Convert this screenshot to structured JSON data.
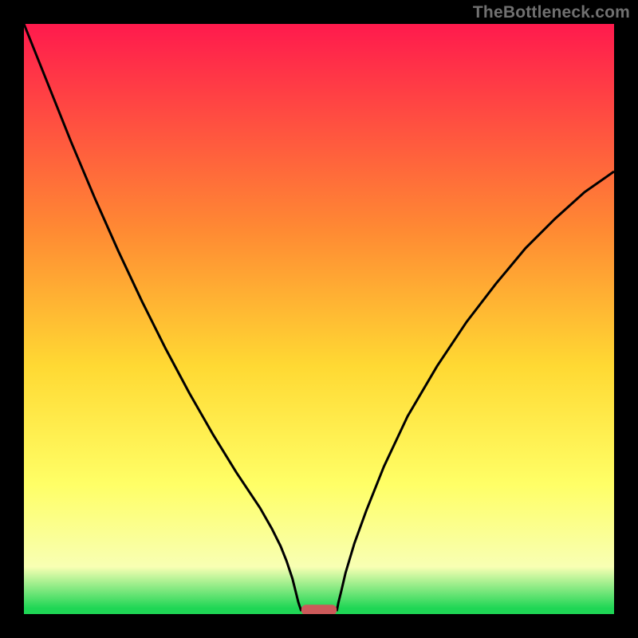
{
  "attribution": "TheBottleneck.com",
  "colors": {
    "frame_bg": "#000000",
    "gradient_top": "#ff1a4d",
    "gradient_mid1": "#ff8a33",
    "gradient_mid2": "#ffd933",
    "gradient_mid3": "#ffff66",
    "gradient_low": "#f8ffb3",
    "gradient_green": "#1fd655",
    "curve": "#000000",
    "marker": "#cc5a5a"
  },
  "chart_data": {
    "type": "line",
    "title": "",
    "xlabel": "",
    "ylabel": "",
    "xlim": [
      0,
      100
    ],
    "ylim": [
      0,
      100
    ],
    "series": [
      {
        "name": "left-curve",
        "x": [
          0,
          2,
          5,
          8,
          12,
          16,
          20,
          24,
          28,
          32,
          36,
          40,
          42,
          43.5,
          44.5,
          45.5,
          46,
          46.5,
          47
        ],
        "y": [
          100,
          95,
          87.5,
          80,
          70.5,
          61.5,
          53,
          45,
          37.5,
          30.5,
          24,
          18,
          14.5,
          11.5,
          9,
          6,
          4,
          2,
          0.5
        ]
      },
      {
        "name": "right-curve",
        "x": [
          53,
          53.3,
          53.8,
          54.5,
          56,
          58,
          61,
          65,
          70,
          75,
          80,
          85,
          90,
          95,
          100
        ],
        "y": [
          0.5,
          2,
          4,
          7,
          12,
          17.5,
          25,
          33.5,
          42,
          49.5,
          56,
          62,
          67,
          71.5,
          75
        ]
      }
    ],
    "marker": {
      "name": "optimal-zone",
      "x_center": 50,
      "x_half_width": 3,
      "y": 0.5
    },
    "legend": [],
    "annotations": []
  }
}
